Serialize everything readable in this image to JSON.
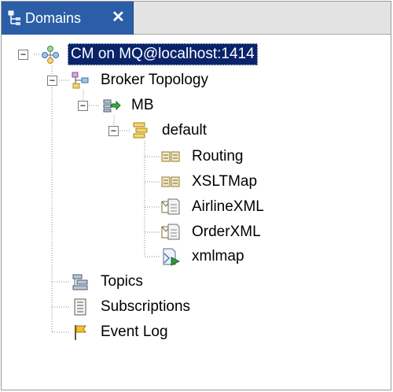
{
  "view": {
    "tab_label": "Domains",
    "close_symbol": "✕"
  },
  "tree": {
    "root": "CM on MQ@localhost:1414",
    "broker_topology": "Broker Topology",
    "broker": "MB",
    "execution_group": "default",
    "flows": [
      "Routing",
      "XSLTMap",
      "AirlineXML",
      "OrderXML",
      "xmlmap"
    ],
    "topics": "Topics",
    "subscriptions": "Subscriptions",
    "event_log": "Event Log"
  },
  "icons": {
    "root": "domain-connection-icon",
    "broker_topology": "topology-icon",
    "broker": "broker-icon",
    "execution_group": "execution-group-icon",
    "flow": "message-flow-icon",
    "message_set": "message-set-icon",
    "mapping": "mapping-icon",
    "topics": "topics-icon",
    "subscriptions": "subscriptions-icon",
    "event_log": "event-log-icon"
  },
  "colors": {
    "tab_active": "#2b5ea6",
    "selection": "#0a246a"
  }
}
